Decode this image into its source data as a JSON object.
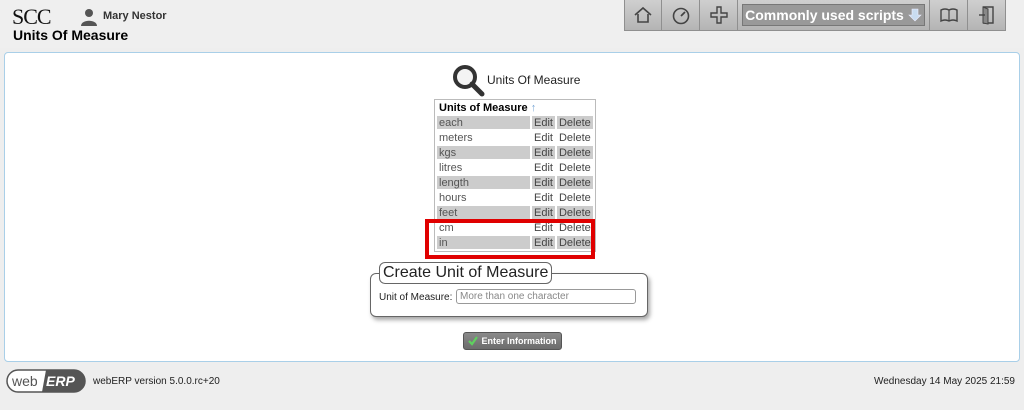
{
  "header": {
    "company": "SCC",
    "user_name": "Mary Nestor",
    "page_heading": "Units Of Measure",
    "toolbar": {
      "scripts_label": "Commonly used scripts",
      "icons": [
        "home-icon",
        "dashboard-icon",
        "add-icon",
        "manual-icon",
        "logout-icon"
      ]
    }
  },
  "main": {
    "title": "Units Of Measure",
    "table": {
      "header": "Units of Measure",
      "sort_indicator": "↑",
      "rows": [
        {
          "name": "each",
          "edit": "Edit",
          "delete": "Delete"
        },
        {
          "name": "meters",
          "edit": "Edit",
          "delete": "Delete"
        },
        {
          "name": "kgs",
          "edit": "Edit",
          "delete": "Delete"
        },
        {
          "name": "litres",
          "edit": "Edit",
          "delete": "Delete"
        },
        {
          "name": "length",
          "edit": "Edit",
          "delete": "Delete"
        },
        {
          "name": "hours",
          "edit": "Edit",
          "delete": "Delete"
        },
        {
          "name": "feet",
          "edit": "Edit",
          "delete": "Delete"
        },
        {
          "name": "cm",
          "edit": "Edit",
          "delete": "Delete"
        },
        {
          "name": "in",
          "edit": "Edit",
          "delete": "Delete"
        }
      ]
    },
    "form": {
      "legend": "Create Unit of Measure",
      "field_label": "Unit of Measure:",
      "field_placeholder": "More than one character",
      "field_value": ""
    },
    "submit_label": "Enter Information"
  },
  "footer": {
    "logo_text": "webERP",
    "version": "webERP version 5.0.0.rc+20",
    "datetime": "Wednesday 14 May 2025 21:59"
  },
  "colors": {
    "highlight": "#e00000",
    "panel_border": "#a9cfe8",
    "row_alt": "#cccccc",
    "button": "#777777"
  }
}
